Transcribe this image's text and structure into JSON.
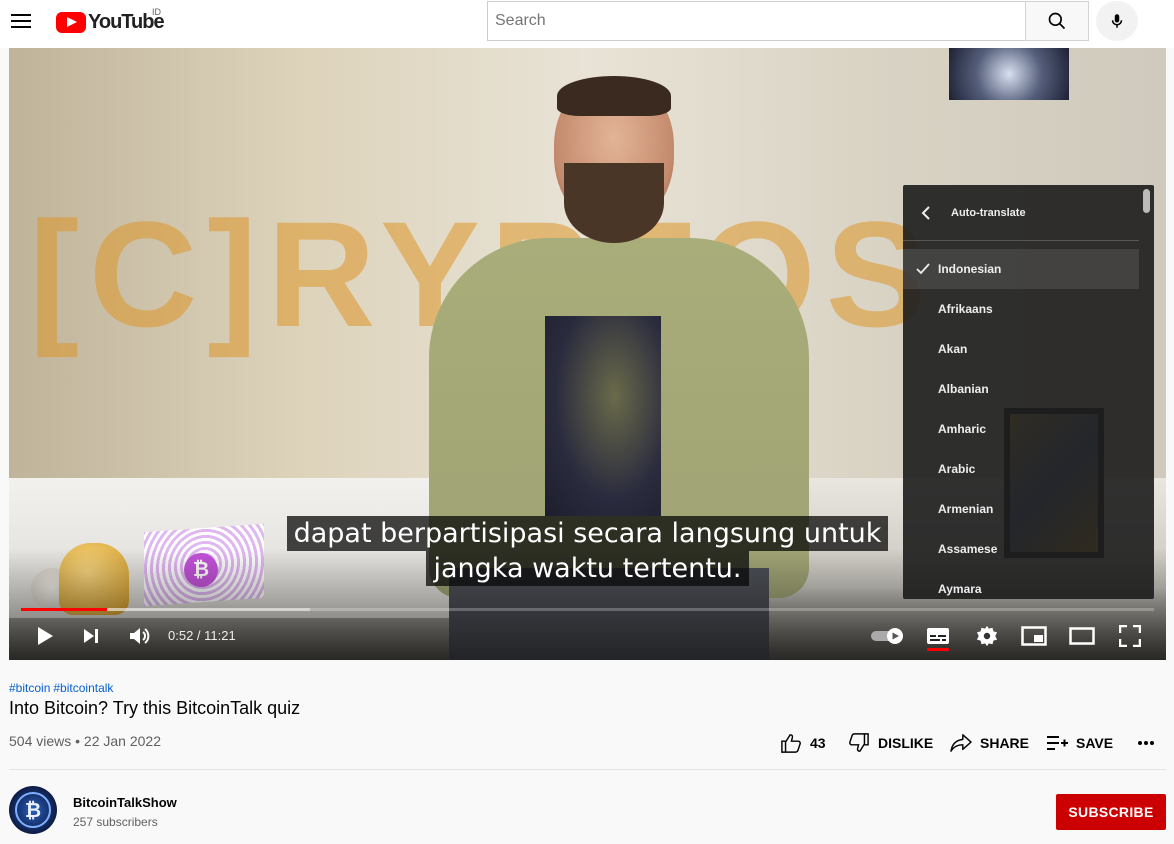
{
  "masthead": {
    "logo_text": "YouTube",
    "country_code": "ID",
    "search_placeholder": "Search"
  },
  "player": {
    "captions": [
      "dapat berpartisipasi secara langsung untuk",
      "jangka waktu tertentu."
    ],
    "time_current": "0:52",
    "time_total": "11:21",
    "time_display": "0:52 / 11:21",
    "progress_played_fraction": 0.076,
    "progress_buffered_fraction": 0.255,
    "settings_menu": {
      "title": "Auto-translate",
      "selected": "Indonesian",
      "items": [
        "Indonesian",
        "Afrikaans",
        "Akan",
        "Albanian",
        "Amharic",
        "Arabic",
        "Armenian",
        "Assamese",
        "Aymara"
      ]
    }
  },
  "video": {
    "hashtags": [
      "#bitcoin",
      "#bitcointalk"
    ],
    "title": "Into Bitcoin? Try this BitcoinTalk quiz",
    "meta": "504 views • 22 Jan 2022",
    "like_count": "43",
    "dislike_label": "DISLIKE",
    "share_label": "SHARE",
    "save_label": "SAVE"
  },
  "channel": {
    "name": "BitcoinTalkShow",
    "subscribers": "257 subscribers",
    "subscribe_label": "SUBSCRIBE"
  },
  "colors": {
    "brand_red": "#ff0000",
    "subscribe_red": "#cc0000",
    "link_blue": "#065fd4"
  }
}
